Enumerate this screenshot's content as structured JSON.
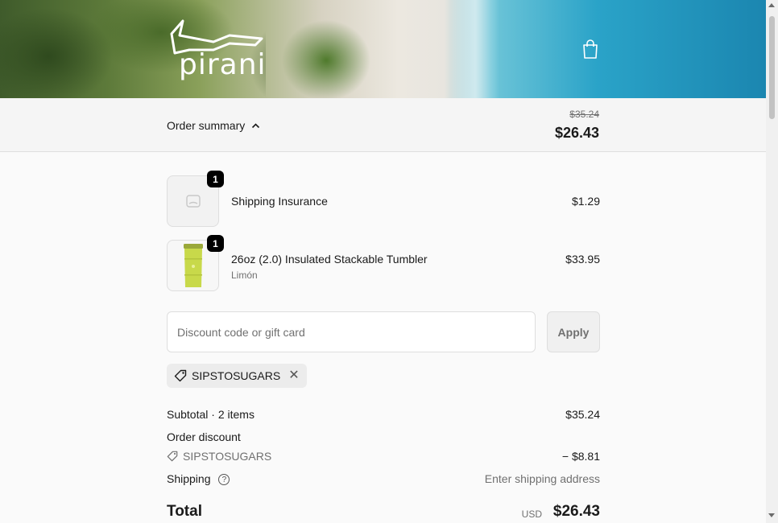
{
  "header": {
    "logo_text": "pirani",
    "cart_icon": "shopping-bag-icon"
  },
  "summary": {
    "toggle_label": "Order summary",
    "original_total": "$35.24",
    "total": "$26.43"
  },
  "items": [
    {
      "name": "Shipping Insurance",
      "variant": "",
      "price": "$1.29",
      "quantity": "1",
      "image_icon": "placeholder-image-icon"
    },
    {
      "name": "26oz (2.0) Insulated Stackable Tumbler",
      "variant": "Limón",
      "price": "$33.95",
      "quantity": "1",
      "image_icon": "tumbler-image",
      "color": "#c8d94a"
    }
  ],
  "discount": {
    "placeholder": "Discount code or gift card",
    "apply_label": "Apply",
    "applied_code": "SIPSTOSUGARS"
  },
  "totals": {
    "subtotal_label": "Subtotal · 2 items",
    "subtotal_value": "$35.24",
    "discount_label": "Order discount",
    "discount_code": "SIPSTOSUGARS",
    "discount_value": "− $8.81",
    "shipping_label": "Shipping",
    "shipping_value": "Enter shipping address",
    "total_label": "Total",
    "currency": "USD",
    "total_value": "$26.43"
  }
}
